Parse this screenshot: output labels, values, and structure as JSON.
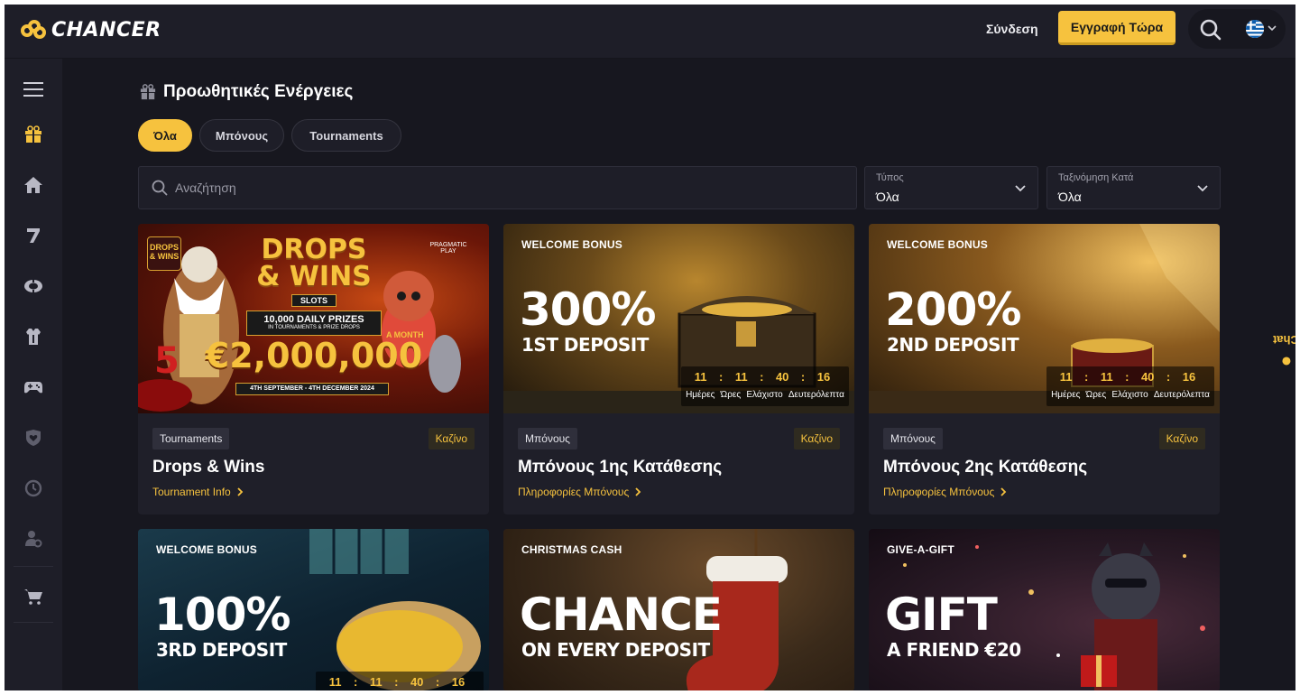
{
  "brand": {
    "name": "CHANCER",
    "accent": "#f6c23e"
  },
  "header": {
    "login_label": "Σύνδεση",
    "register_label": "Εγγραφή Τώρα",
    "search_icon": "search-icon",
    "language_icon": "greek-flag-icon"
  },
  "sidebar": {
    "icons": [
      "menu-icon",
      "gift-icon",
      "home-icon",
      "slots-seven-icon",
      "live-casino-chip-icon",
      "sports-shirt-icon",
      "gamepad-icon",
      "heart-shield-icon",
      "clock-icon",
      "user-settings-icon",
      "cart-icon"
    ]
  },
  "page": {
    "title": "Προωθητικές Ενέργειες",
    "tabs": [
      {
        "label": "Όλα",
        "active": true
      },
      {
        "label": "Μπόνους",
        "active": false
      },
      {
        "label": "Tournaments",
        "active": false
      }
    ],
    "search_placeholder": "Αναζήτηση",
    "type_filter": {
      "label": "Τύπος",
      "value": "Όλα"
    },
    "sort_filter": {
      "label": "Ταξινόμηση Κατά",
      "value": "Όλα"
    }
  },
  "countdown": {
    "days": "11",
    "hours": "11",
    "minutes": "40",
    "seconds": "16",
    "sep": ":",
    "units": [
      "Ημέρες",
      "Ώρες",
      "Ελάχιστο",
      "Δευτερόλεπτα"
    ]
  },
  "cards": [
    {
      "banner": {
        "title_line1": "DROPS",
        "title_line2": "& WINS",
        "subtitle": "SLOTS",
        "prizes": "10,000 DAILY PRIZES",
        "prizes_sub": "IN TOURNAMENTS & PRIZE DROPS",
        "amount": "€2,000,000",
        "per": "A MONTH",
        "dates": "4TH SEPTEMBER - 4TH DECEMBER 2024",
        "provider": "PRAGMATIC PLAY",
        "corner": "DROPS & WINS"
      },
      "category": "Tournaments",
      "type": "Καζίνο",
      "title": "Drops & Wins",
      "link": "Tournament Info"
    },
    {
      "tag": "WELCOME BONUS",
      "big": "300%",
      "sub": "1ST DEPOSIT",
      "category": "Μπόνους",
      "type": "Καζίνο",
      "title": "Μπόνους 1ης Κατάθεσης",
      "link": "Πληροφορίες Μπόνους"
    },
    {
      "tag": "WELCOME BONUS",
      "big": "200%",
      "sub": "2ND DEPOSIT",
      "category": "Μπόνους",
      "type": "Καζίνο",
      "title": "Μπόνους 2ης Κατάθεσης",
      "link": "Πληροφορίες Μπόνους"
    },
    {
      "tag": "WELCOME BONUS",
      "big": "100%",
      "sub": "3RD DEPOSIT"
    },
    {
      "tag": "CHRISTMAS CASH",
      "big": "CHANCE",
      "sub": "ON EVERY DEPOSIT"
    },
    {
      "tag": "GIVE-A-GIFT",
      "big": "GIFT",
      "sub": "A FRIEND €20"
    }
  ],
  "chat": {
    "label": "Chat"
  }
}
